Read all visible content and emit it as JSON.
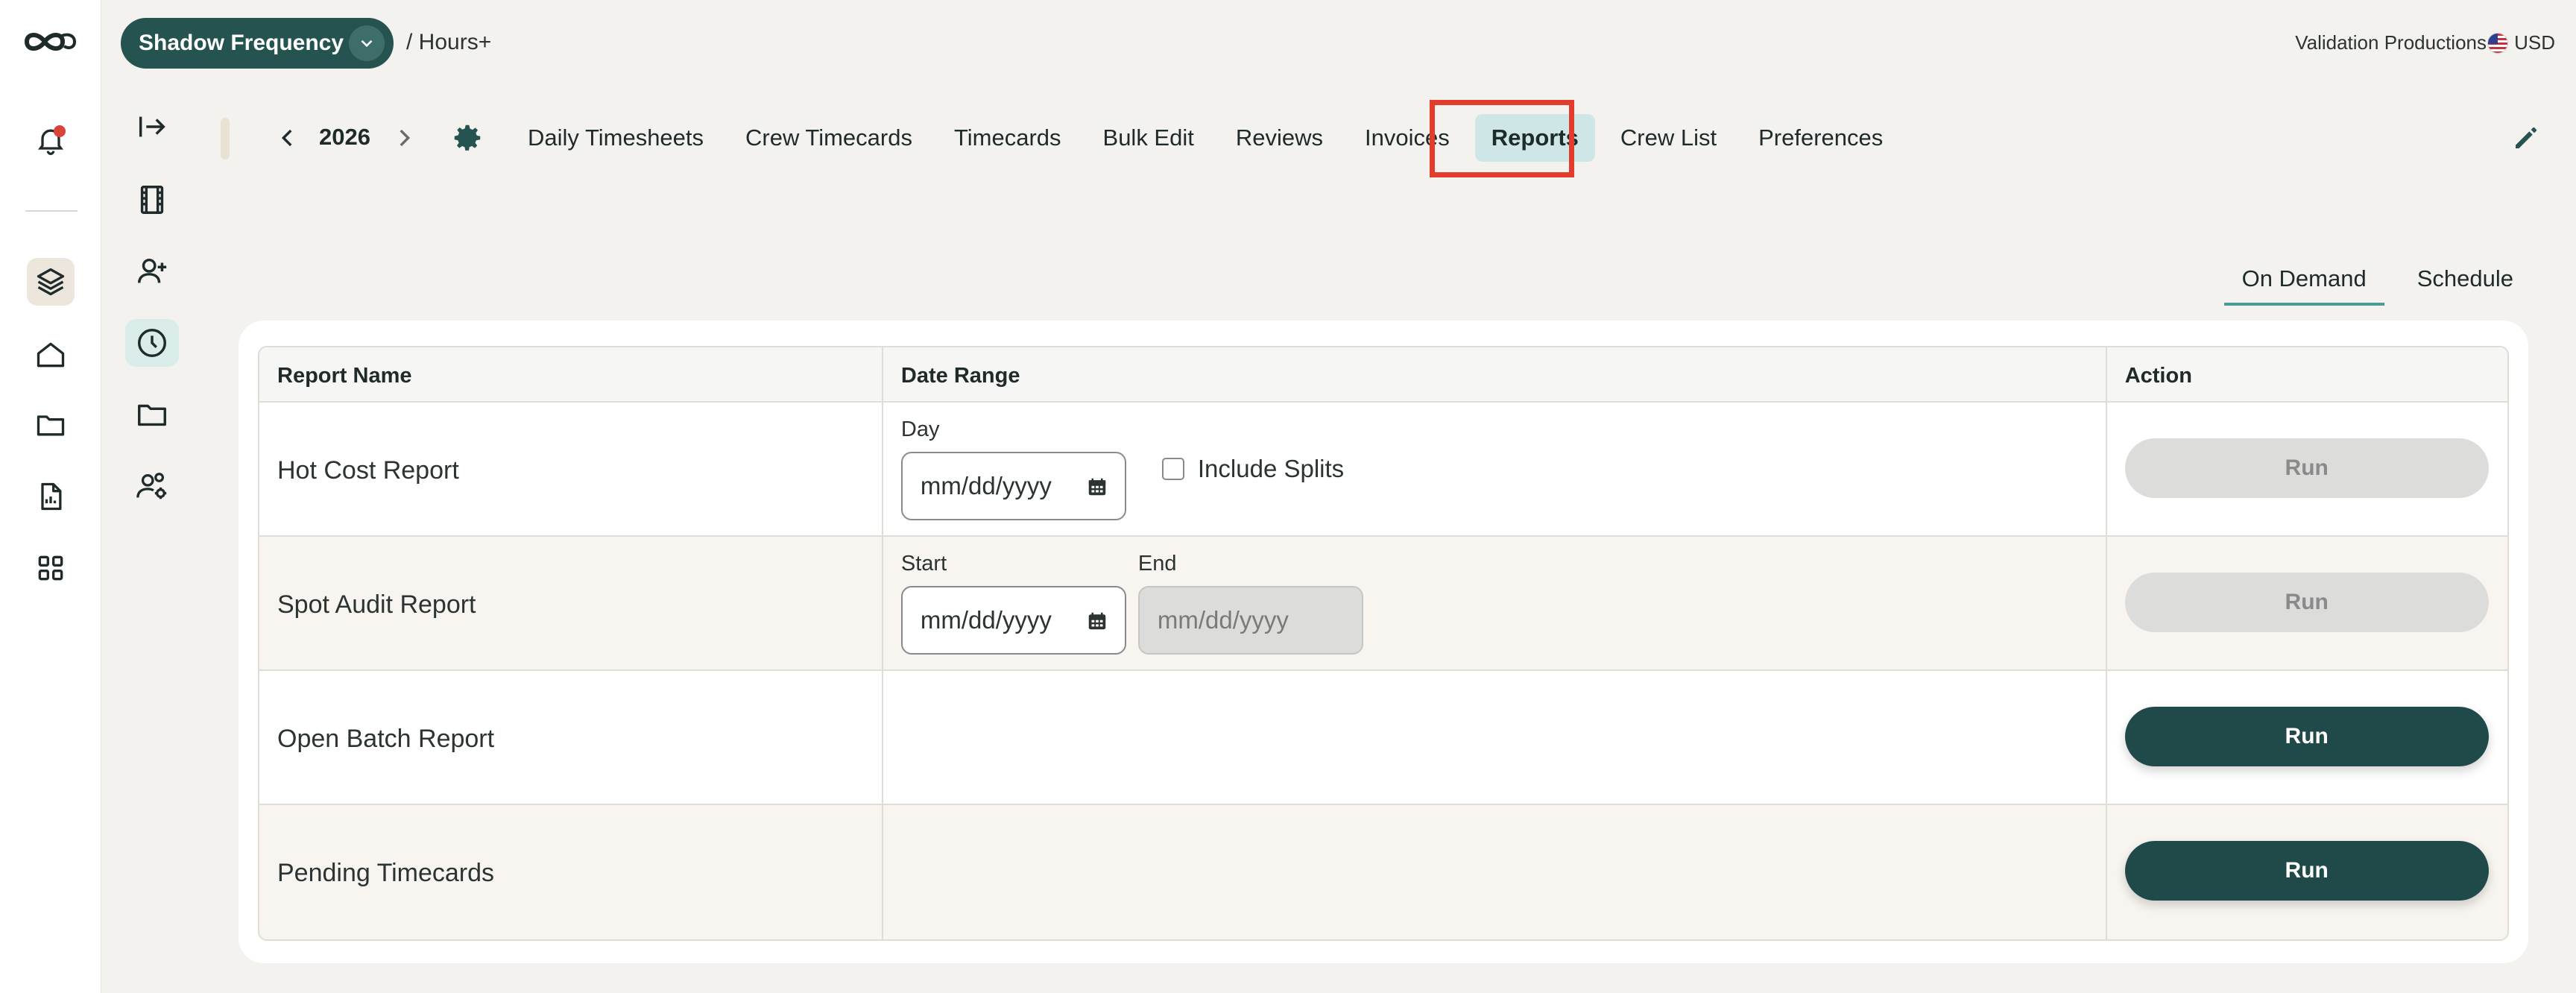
{
  "header": {
    "production_name": "Shadow Frequency",
    "breadcrumb": "/ Hours+",
    "company": "Validation Productions",
    "currency": "USD"
  },
  "nav": {
    "year": "2026",
    "tabs": [
      {
        "label": "Daily Timesheets",
        "selected": false
      },
      {
        "label": "Crew Timecards",
        "selected": false
      },
      {
        "label": "Timecards",
        "selected": false
      },
      {
        "label": "Bulk Edit",
        "selected": false
      },
      {
        "label": "Reviews",
        "selected": false
      },
      {
        "label": "Invoices",
        "selected": false
      },
      {
        "label": "Reports",
        "selected": true
      },
      {
        "label": "Crew List",
        "selected": false
      },
      {
        "label": "Preferences",
        "selected": false
      }
    ]
  },
  "view_tabs": {
    "on_demand": "On Demand",
    "schedule": "Schedule",
    "selected": "On Demand"
  },
  "table": {
    "headers": {
      "report_name": "Report Name",
      "date_range": "Date Range",
      "action": "Action"
    },
    "rows": [
      {
        "name": "Hot Cost Report",
        "day_label": "Day",
        "day_placeholder": "mm/dd/yyyy",
        "checkbox_label": "Include Splits",
        "checkbox_checked": false,
        "run_label": "Run",
        "run_enabled": false
      },
      {
        "name": "Spot Audit Report",
        "start_label": "Start",
        "start_placeholder": "mm/dd/yyyy",
        "end_label": "End",
        "end_placeholder": "mm/dd/yyyy",
        "run_label": "Run",
        "run_enabled": false
      },
      {
        "name": "Open Batch Report",
        "run_label": "Run",
        "run_enabled": true
      },
      {
        "name": "Pending Timecards",
        "run_label": "Run",
        "run_enabled": true
      }
    ]
  },
  "colors": {
    "brand": "#255350",
    "run_enabled": "#1f4a49",
    "selected_tab": "#cfe6e6",
    "highlight": "#e43c2c",
    "notification": "#d9443a"
  },
  "icons": {
    "rail": [
      "logo-icon",
      "notification-bell-icon",
      "layers-icon",
      "home-icon",
      "folder-icon",
      "report-document-icon",
      "apps-grid-icon"
    ],
    "sidebar": [
      "collapse-sidebar-icon",
      "film-icon",
      "add-user-icon",
      "clock-icon",
      "folder-icon",
      "team-settings-icon"
    ]
  }
}
